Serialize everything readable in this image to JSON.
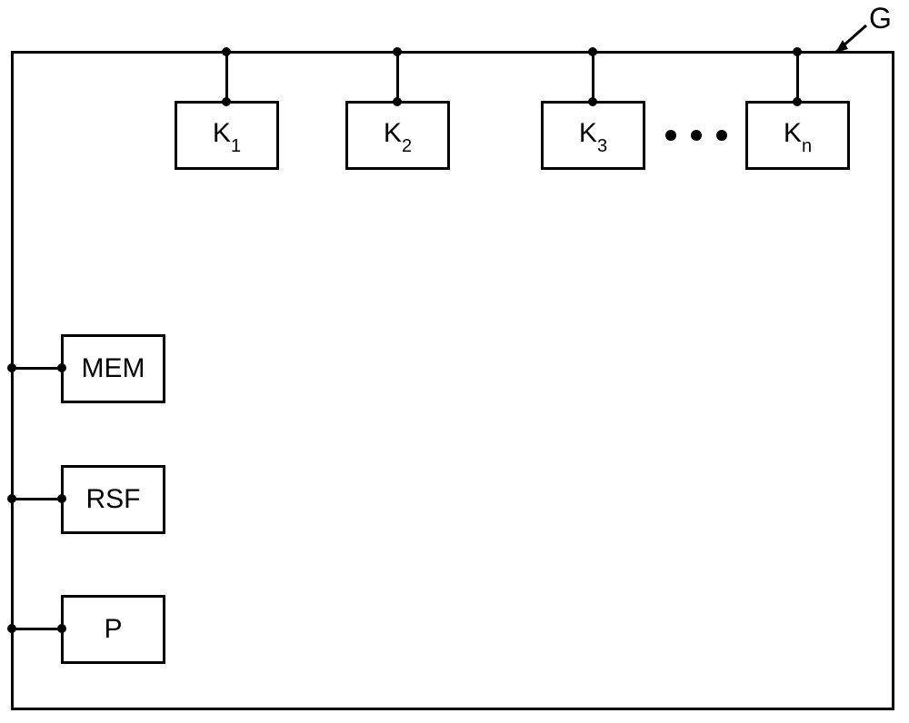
{
  "outer_label": "G",
  "top_blocks": [
    {
      "label": "K",
      "sub": "1"
    },
    {
      "label": "K",
      "sub": "2"
    },
    {
      "label": "K",
      "sub": "3"
    },
    {
      "label": "K",
      "sub": "n"
    }
  ],
  "left_blocks": [
    {
      "label": "MEM"
    },
    {
      "label": "RSF"
    },
    {
      "label": "P"
    }
  ],
  "chart_data": {
    "type": "diagram",
    "title": "",
    "outer_container": "G",
    "components_top_bus": [
      "K_1",
      "K_2",
      "K_3",
      "...",
      "K_n"
    ],
    "components_left_bus": [
      "MEM",
      "RSF",
      "P"
    ],
    "annotations": [
      "G arrow pointing to outer box top-right corner",
      "ellipsis between K_3 and K_n"
    ]
  }
}
